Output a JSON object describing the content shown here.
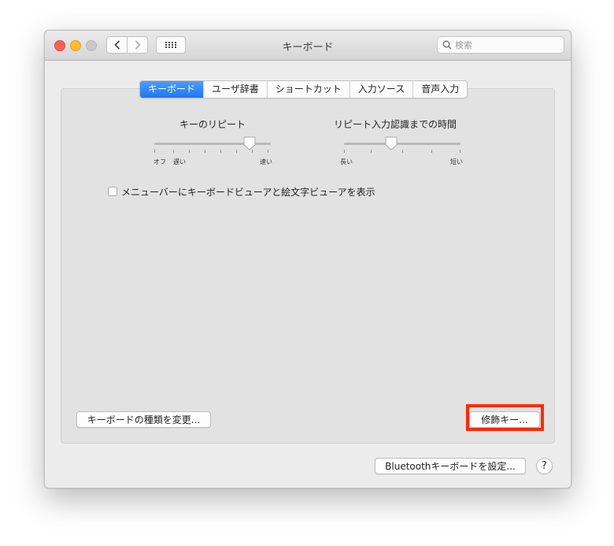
{
  "window": {
    "title": "キーボード"
  },
  "search": {
    "placeholder": "検索"
  },
  "tabs": [
    {
      "label": "キーボード",
      "active": true
    },
    {
      "label": "ユーザ辞書",
      "active": false
    },
    {
      "label": "ショートカット",
      "active": false
    },
    {
      "label": "入力ソース",
      "active": false
    },
    {
      "label": "音声入力",
      "active": false
    }
  ],
  "key_repeat": {
    "label": "キーのリピート",
    "min_label": "オフ",
    "slow_label": "遅い",
    "max_label": "速い",
    "value": 0.8
  },
  "delay": {
    "label": "リピート入力認識までの時間",
    "min_label": "長い",
    "max_label": "短い",
    "value": 0.4
  },
  "checkbox": {
    "label": "メニューバーにキーボードビューアと絵文字ビューアを表示",
    "checked": false
  },
  "buttons": {
    "change_type": "キーボードの種類を変更...",
    "modifier_keys": "修飾キー...",
    "bluetooth": "Bluetoothキーボードを設定...",
    "help": "?"
  },
  "colors": {
    "accent": "#1d78f2",
    "highlight": "#ff2a00"
  },
  "icons": [
    "back-chevron-icon",
    "forward-chevron-icon",
    "grid-icon",
    "magnifier-icon"
  ]
}
